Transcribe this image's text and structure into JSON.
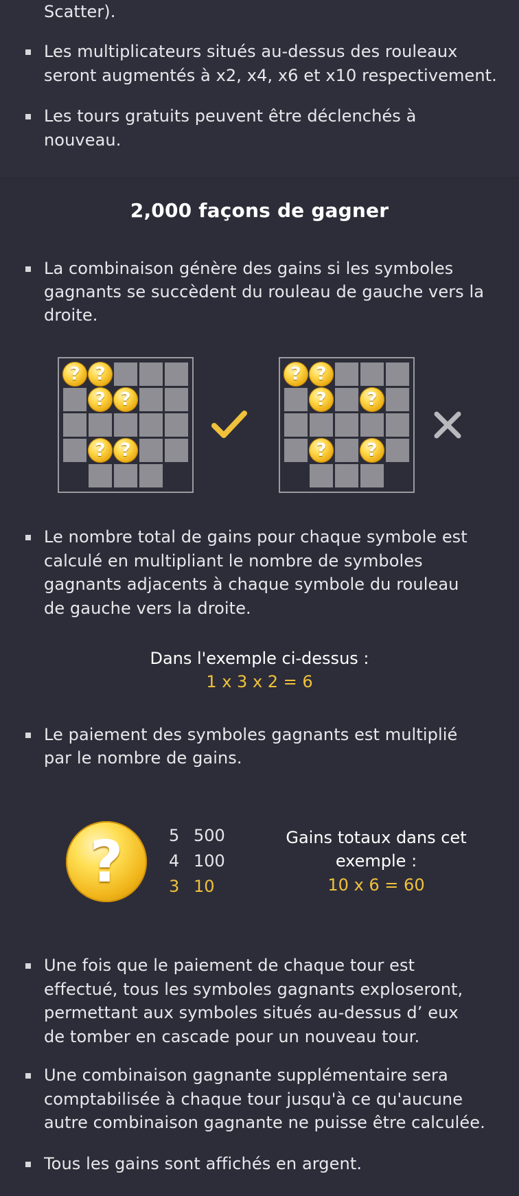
{
  "top_section": {
    "lines": [
      "Scatter).",
      "Les multiplicateurs situés au-dessus des rouleaux",
      "seront augmentés à x2, x4, x6 et x10 respectivement.",
      "Les tours gratuits peuvent être déclenchés à",
      "nouveau."
    ]
  },
  "ways": {
    "heading": "2,000 façons de gagner",
    "bullet1": [
      "La combinaison génère des gains si les symboles",
      "gagnants se succèdent du rouleau de gauche vers la",
      "droite."
    ],
    "diagram_valid_icon": "check-icon",
    "diagram_invalid_icon": "cross-icon",
    "coin_symbol": "?",
    "colors": {
      "accent": "#f0c13a",
      "cell": "#8e8e94",
      "border": "#9a9aa0"
    },
    "bullet2": [
      "Le nombre total de gains pour chaque symbole est",
      "calculé en multipliant le nombre de symboles",
      "gagnants adjacents à chaque symbole du rouleau",
      "de gauche vers la droite."
    ],
    "example_label": "Dans l'exemple ci-dessus :",
    "example_formula": "1 x 3 x 2 = 6",
    "bullet3": [
      "Le paiement des symboles gagnants est multiplié",
      "par le nombre de gains."
    ],
    "paytable": [
      {
        "count": "5",
        "value": "500"
      },
      {
        "count": "4",
        "value": "100"
      },
      {
        "count": "3",
        "value": "10"
      }
    ],
    "total_label_1": "Gains totaux dans cet",
    "total_label_2": "exemple :",
    "total_formula": "10 x 6 = 60",
    "bullet4": [
      "Une fois que le paiement de chaque tour est",
      "effectué, tous les symboles gagnants exploseront,",
      "permettant aux symboles situés au-dessus d’ eux",
      "de tomber en cascade pour un nouveau tour."
    ],
    "bullet5": [
      "Une combinaison gagnante supplémentaire sera",
      "comptabilisée à chaque tour jusqu'à ce qu'aucune",
      "autre combinaison gagnante ne puisse être calculée."
    ],
    "bullet6": [
      "Tous les gains sont affichés en argent."
    ]
  }
}
